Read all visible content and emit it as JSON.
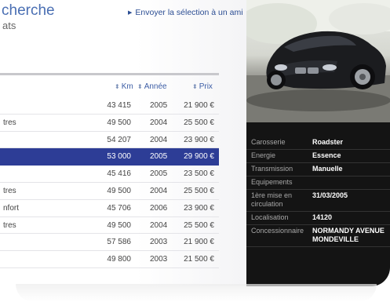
{
  "header": {
    "title": "cherche",
    "subtitle": "ats",
    "send_link": "Envoyer la sélection à un ami"
  },
  "table": {
    "columns": {
      "km": "Km",
      "year": "Année",
      "price": "Prix"
    },
    "rows": [
      {
        "name": "",
        "km": "43 415",
        "year": "2005",
        "price": "21 900 €"
      },
      {
        "name": "tres",
        "km": "49 500",
        "year": "2004",
        "price": "25 500 €"
      },
      {
        "name": "",
        "km": "54 207",
        "year": "2004",
        "price": "23 900 €"
      },
      {
        "name": "",
        "km": "53 000",
        "year": "2005",
        "price": "29 900 €"
      },
      {
        "name": "",
        "km": "45 416",
        "year": "2005",
        "price": "23 500 €"
      },
      {
        "name": "tres",
        "km": "49 500",
        "year": "2004",
        "price": "25 500 €"
      },
      {
        "name": "nfort",
        "km": "45 706",
        "year": "2006",
        "price": "23 900 €"
      },
      {
        "name": "tres",
        "km": "49 500",
        "year": "2004",
        "price": "25 500 €"
      },
      {
        "name": "",
        "km": "57 586",
        "year": "2003",
        "price": "21 900 €"
      },
      {
        "name": "",
        "km": "49 800",
        "year": "2003",
        "price": "21 500 €"
      }
    ],
    "selected_index": 3
  },
  "details": {
    "photo_icon": "car-photo",
    "specs": [
      {
        "label": "Carosserie",
        "value": "Roadster"
      },
      {
        "label": "Energie",
        "value": "Essence"
      },
      {
        "label": "Transmission",
        "value": "Manuelle"
      },
      {
        "label": "Equipements",
        "value": ""
      },
      {
        "label": "1ère mise en circulation",
        "value": "31/03/2005"
      },
      {
        "label": "Localisation",
        "value": "14120"
      },
      {
        "label": "Concessionnaire",
        "value": "NORMANDY AVENUE MONDEVILLE"
      }
    ]
  },
  "colors": {
    "accent": "#2d3d96",
    "link": "#2b4d93",
    "panel": "#141414"
  }
}
